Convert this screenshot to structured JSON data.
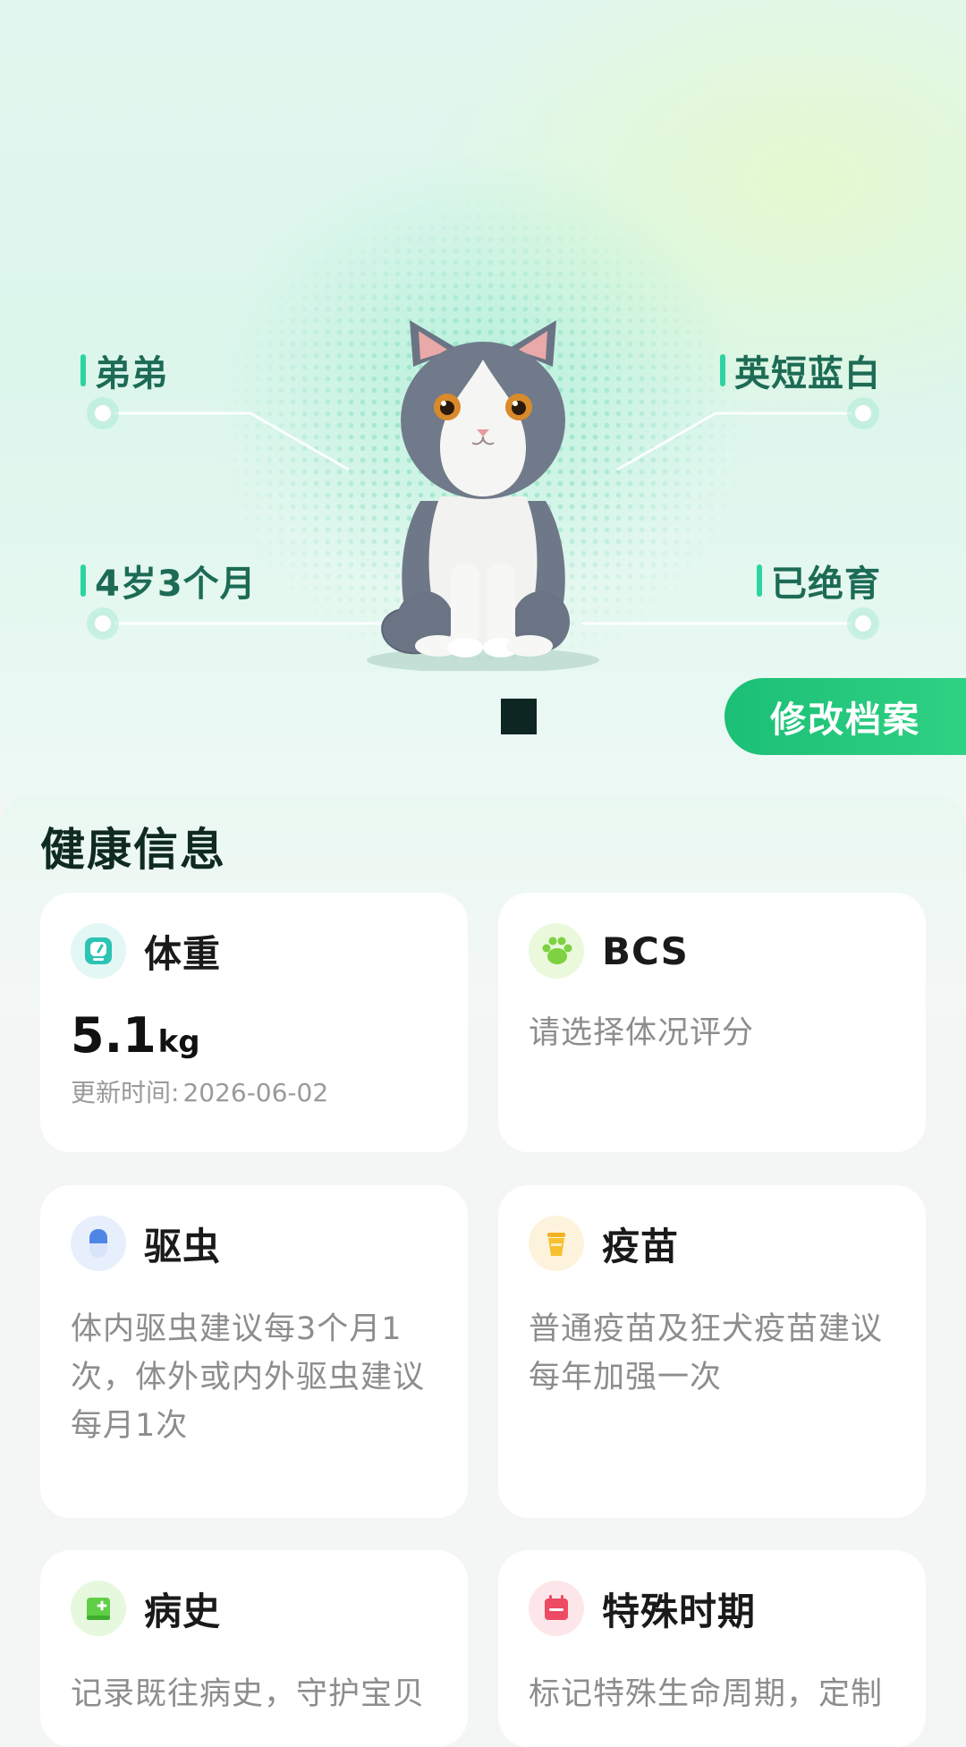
{
  "pet": {
    "nickname": "弟弟",
    "breed": "英短蓝白",
    "age": "4岁3个月",
    "status": "已绝育"
  },
  "actions": {
    "edit_profile": "修改档案"
  },
  "health": {
    "section_title": "健康信息",
    "cards": {
      "weight": {
        "title": "体重",
        "value": "5.1",
        "unit": "kg",
        "updated_label": "更新时间:",
        "updated_date": "2026-06-02",
        "icon": "scale-icon"
      },
      "bcs": {
        "title": "BCS",
        "description": "请选择体况评分",
        "icon": "paw-icon"
      },
      "deworming": {
        "title": "驱虫",
        "description": "体内驱虫建议每3个月1次，体外或内外驱虫建议每月1次",
        "icon": "capsule-icon"
      },
      "vaccine": {
        "title": "疫苗",
        "description": "普通疫苗及狂犬疫苗建议每年加强一次",
        "icon": "vaccine-cup-icon"
      },
      "history": {
        "title": "病史",
        "description": "记录既往病史，守护宝贝",
        "icon": "medical-record-icon"
      },
      "special_period": {
        "title": "特殊时期",
        "description": "标记特殊生命周期，定制",
        "icon": "calendar-icon"
      }
    }
  },
  "colors": {
    "accent_green": "#1bbf76",
    "tag_bar": "#2ed3a2",
    "tag_text": "#1d6b55"
  }
}
